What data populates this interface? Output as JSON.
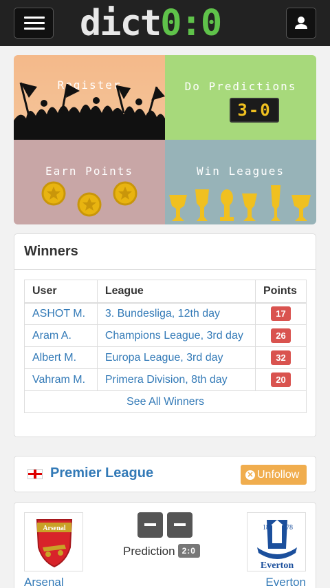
{
  "navbar": {
    "logo_text": "dict",
    "logo_score": "0:0",
    "menu_icon": "hamburger-icon",
    "user_icon": "user-icon"
  },
  "hero": {
    "tiles": [
      {
        "caption": "Register",
        "icon": "crowd-flags-icon"
      },
      {
        "caption": "Do Predictions",
        "scoreboard": "3-0",
        "icon": "scoreboard-icon"
      },
      {
        "caption": "Earn Points",
        "icon": "coins-icon"
      },
      {
        "caption": "Win Leagues",
        "icon": "trophies-icon"
      }
    ]
  },
  "winners": {
    "title": "Winners",
    "columns": [
      "User",
      "League",
      "Points"
    ],
    "rows": [
      {
        "user": "ASHOT M.",
        "league": "3. Bundesliga, 12th day",
        "points": "17"
      },
      {
        "user": "Aram A.",
        "league": "Champions League, 3rd day",
        "points": "26"
      },
      {
        "user": "Albert M.",
        "league": "Europa League, 3rd day",
        "points": "32"
      },
      {
        "user": "Vahram M.",
        "league": "Primera Division, 8th day",
        "points": "20"
      }
    ],
    "see_all": "See All Winners"
  },
  "league": {
    "name": "Premier League",
    "flag_icon": "england-flag-icon",
    "unfollow_label": "Unfollow"
  },
  "match": {
    "home_team": "Arsenal",
    "away_team": "Everton",
    "home_crest_text": "Arsenal",
    "away_crest_text": "Everton",
    "prediction_label": "Prediction",
    "prediction_value": "2:0"
  },
  "colors": {
    "accent_blue": "#337ab7",
    "brand_green": "#5fc24a",
    "points_red": "#d9534f",
    "unfollow_orange": "#f0ad4e"
  }
}
